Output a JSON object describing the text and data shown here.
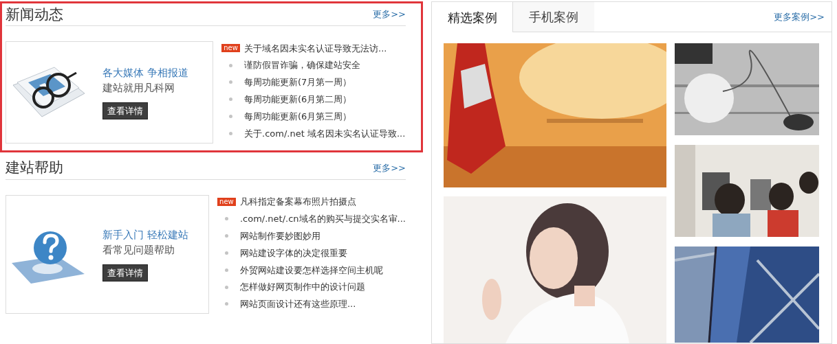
{
  "sections": [
    {
      "title": "新闻动态",
      "more": "更多>>",
      "highlighted": true,
      "promo": {
        "kind": "news",
        "line1": "各大媒体 争相报道",
        "line2": "建站就用凡科网",
        "button": "查看详情"
      },
      "items": [
        {
          "text": "关于域名因未实名认证导致无法访...",
          "badge": "new"
        },
        {
          "text": "谨防假冒诈骗，确保建站安全"
        },
        {
          "text": "每周功能更新(7月第一周）"
        },
        {
          "text": "每周功能更新(6月第二周）"
        },
        {
          "text": "每周功能更新(6月第三周）"
        },
        {
          "text": "关于.com/.net 域名因未实名认证导致..."
        }
      ]
    },
    {
      "title": "建站帮助",
      "more": "更多>>",
      "highlighted": false,
      "promo": {
        "kind": "help",
        "line1": "新手入门 轻松建站",
        "line2": "看常见问题帮助",
        "button": "查看详情"
      },
      "items": [
        {
          "text": "凡科指定备案幕布照片拍摄点",
          "badge": "new"
        },
        {
          "text": ".com/.net/.cn域名的购买与提交实名审..."
        },
        {
          "text": "网站制作要妙图妙用"
        },
        {
          "text": "网站建设字体的决定很重要"
        },
        {
          "text": "外贸网站建设要怎样选择空间主机呢"
        },
        {
          "text": "怎样做好网页制作中的设计问题"
        },
        {
          "text": "网站页面设计还有这些原理..."
        }
      ]
    }
  ],
  "cases": {
    "tabs": [
      {
        "label": "精选案例",
        "selected": true
      },
      {
        "label": "手机案例",
        "selected": false
      }
    ],
    "more": "更多案例>>"
  }
}
